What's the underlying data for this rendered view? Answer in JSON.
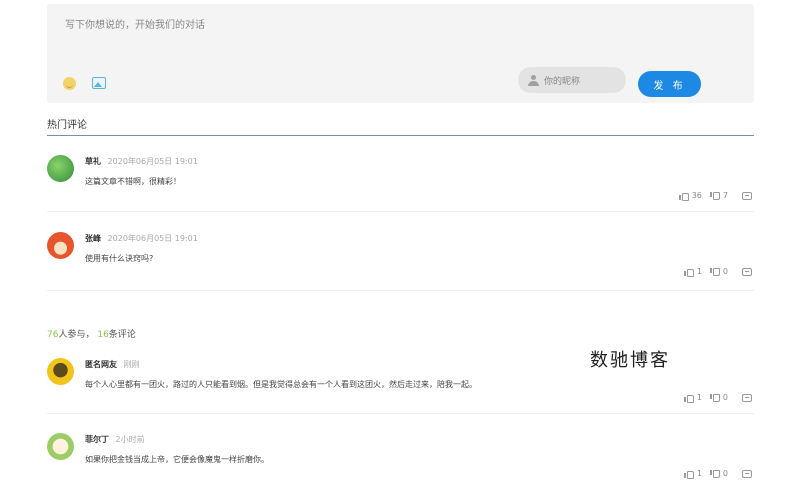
{
  "composer": {
    "placeholder": "写下你想说的，开始我们的对话",
    "nickname_placeholder": "你的昵称",
    "publish_label": "发 布"
  },
  "hot_section": {
    "title": "热门评论"
  },
  "hot_comments": [
    {
      "name": "草礼",
      "time": "2020年06月05日 19:01",
      "text": "这篇文章不错啊，很精彩！",
      "likes": "36",
      "dislikes": "7",
      "avatar_color": "#4caf50"
    },
    {
      "name": "张峰",
      "time": "2020年06月05日 19:01",
      "text": "使用有什么诀窍吗?",
      "likes": "1",
      "dislikes": "0",
      "avatar_color": "#e8542b"
    }
  ],
  "stats": {
    "participants": "76",
    "participants_label": "人参与，",
    "comments": "16",
    "comments_label": "条评论"
  },
  "comments": [
    {
      "name": "匿名网友",
      "time": "刚刚",
      "text": "每个人心里都有一团火，路过的人只能看到烟。但是我觉得总会有一个人看到这团火，然后走过来，陪我一起。",
      "likes": "1",
      "dislikes": "0",
      "avatar_color": "#f2c318"
    },
    {
      "name": "菲尔丁",
      "time": "2小时前",
      "text": "如果你把金钱当成上帝，它便会像魔鬼一样折磨你。",
      "likes": "1",
      "dislikes": "0",
      "avatar_color": "#9ccc65"
    }
  ],
  "watermark": "数驰博客",
  "colors": {
    "accent": "#1e88e5",
    "count_highlight": "#8bc34a"
  }
}
